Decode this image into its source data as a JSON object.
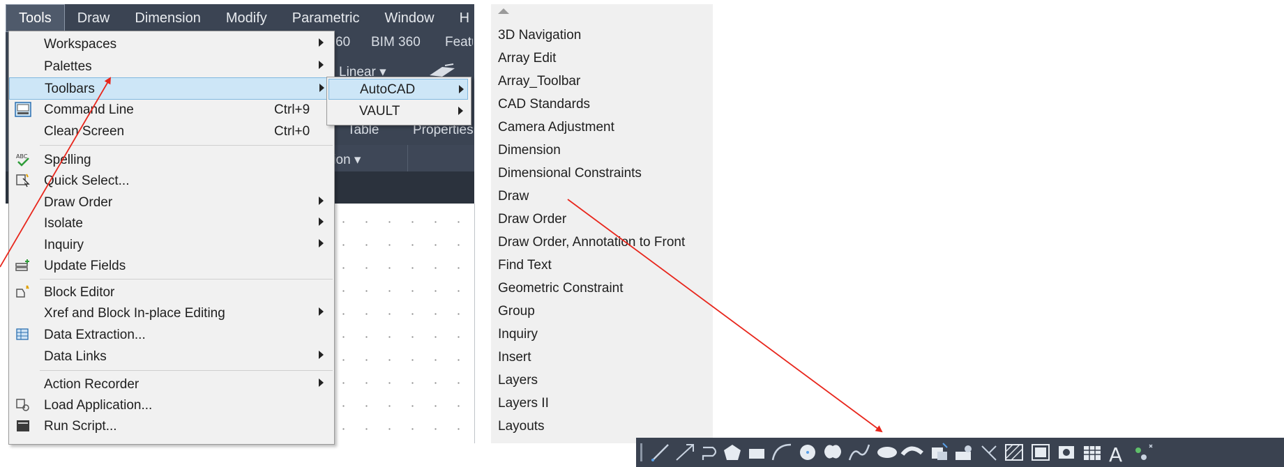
{
  "menu_bar": {
    "items": [
      {
        "label": "Tools",
        "active": true
      },
      {
        "label": "Draw"
      },
      {
        "label": "Dimension"
      },
      {
        "label": "Modify"
      },
      {
        "label": "Parametric"
      },
      {
        "label": "Window"
      },
      {
        "label": "H"
      }
    ]
  },
  "background": {
    "tab_bim360": "BIM 360",
    "tab_partial_360": "60",
    "tab_feature": "Featu",
    "linear": "Linear",
    "table": "Table",
    "properties": "Properties",
    "annotation_partial": "tion"
  },
  "tools_menu": {
    "items": [
      {
        "label": "Workspaces",
        "submenu": true
      },
      {
        "label": "Palettes",
        "submenu": true
      },
      {
        "label": "Toolbars",
        "submenu": true,
        "highlighted": true
      },
      {
        "label": "Command Line",
        "shortcut": "Ctrl+9",
        "icon": "command-line-icon"
      },
      {
        "label": "Clean Screen",
        "shortcut": "Ctrl+0"
      },
      {
        "label": "Spelling",
        "icon": "spelling-icon"
      },
      {
        "label": "Quick Select...",
        "icon": "quick-select-icon"
      },
      {
        "label": "Draw Order",
        "submenu": true
      },
      {
        "label": "Isolate",
        "submenu": true
      },
      {
        "label": "Inquiry",
        "submenu": true
      },
      {
        "label": "Update Fields",
        "icon": "update-fields-icon"
      },
      {
        "label": "Block Editor",
        "icon": "block-editor-icon"
      },
      {
        "label": "Xref and Block In-place Editing",
        "submenu": true
      },
      {
        "label": "Data Extraction...",
        "icon": "data-extraction-icon"
      },
      {
        "label": "Data Links",
        "submenu": true
      },
      {
        "label": "Action Recorder",
        "submenu": true
      },
      {
        "label": "Load Application...",
        "icon": "load-application-icon"
      },
      {
        "label": "Run Script...",
        "icon": "run-script-icon"
      }
    ]
  },
  "toolbars_submenu": {
    "items": [
      {
        "label": "AutoCAD",
        "submenu": true,
        "highlighted": true
      },
      {
        "label": "VAULT",
        "submenu": true
      }
    ]
  },
  "autocad_toolbar_list": {
    "items": [
      "3D Navigation",
      "Array Edit",
      "Array_Toolbar",
      "CAD Standards",
      "Camera Adjustment",
      "Dimension",
      "Dimensional Constraints",
      "Draw",
      "Draw Order",
      "Draw Order, Annotation to Front",
      "Find Text",
      "Geometric Constraint",
      "Group",
      "Inquiry",
      "Insert",
      "Layers",
      "Layers II",
      "Layouts"
    ]
  },
  "draw_toolbar": {
    "icons": [
      "line-icon",
      "construction-line-icon",
      "polyline-icon",
      "polygon-icon",
      "rectangle-icon",
      "arc-icon",
      "circle-icon",
      "revision-cloud-icon",
      "spline-icon",
      "ellipse-icon",
      "ellipse-arc-icon",
      "insert-block-icon",
      "make-block-icon",
      "point-icon",
      "hatch-icon",
      "gradient-icon",
      "region-icon",
      "table-icon",
      "multiline-text-icon",
      "add-selected-icon"
    ],
    "text_icon_glyph": "A"
  },
  "colors": {
    "app_dark": "#3b4453",
    "menu_bg": "#f1f1f1",
    "highlight": "#cde6f7",
    "annotation_arrow": "#e8261c"
  }
}
